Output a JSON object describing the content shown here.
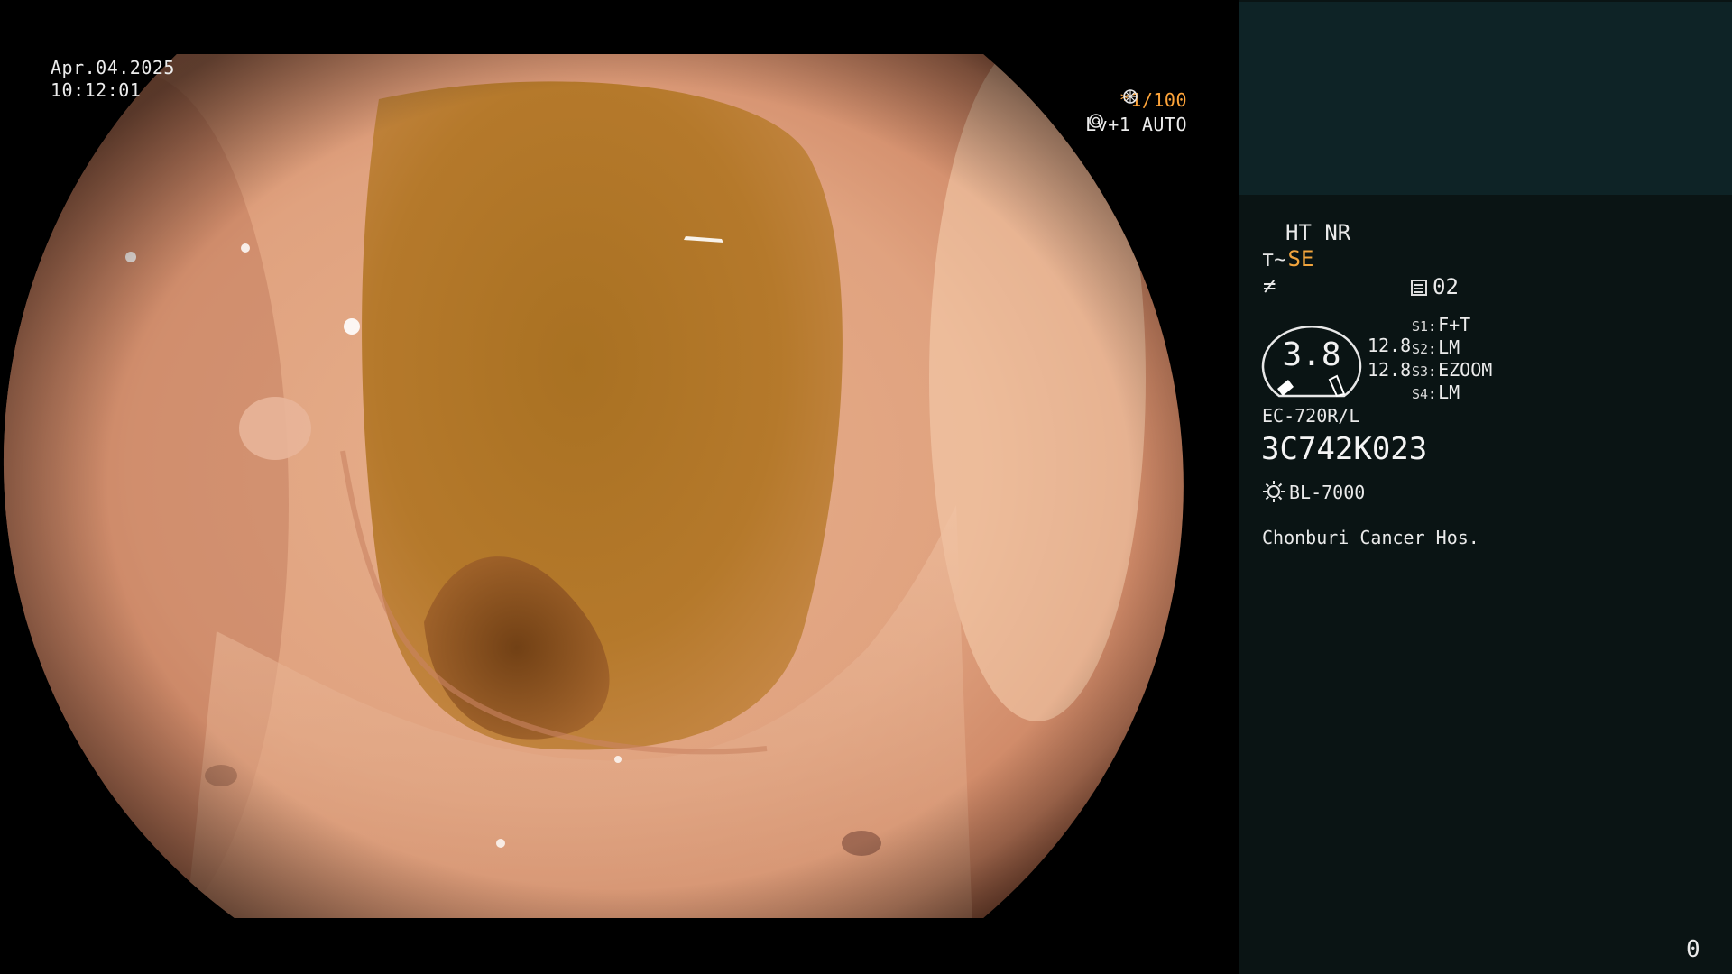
{
  "image": {
    "description_icon": "endoscope-lumen-view",
    "colors": {
      "mucosa": "#d89a78",
      "lumen": "#b57a25",
      "panel_bg": "#0a1414",
      "thumb_bg": "#0e2326",
      "accent_orange": "#f2a53d"
    }
  },
  "overlay": {
    "date": "Apr.04.2025",
    "time": "10:12:01",
    "shutter": "*1/100",
    "shutter_icon": "shutter-icon",
    "iris": "Lv+1 AUTO",
    "iris_icon": "iris-icon"
  },
  "panel": {
    "mode": "HT NR",
    "enhance_symbol": "⊤~",
    "enhance": "SE",
    "fh_symbol": "≠",
    "record_icon": "record-list-icon",
    "record_value": "02",
    "zoom_value": "3.8",
    "contrast_top": "12.8",
    "contrast_bottom": "12.8",
    "switches": [
      {
        "key": "S1:",
        "value": "F+T"
      },
      {
        "key": "S2:",
        "value": "LM"
      },
      {
        "key": "S3:",
        "value": "EZOOM"
      },
      {
        "key": "S4:",
        "value": "LM"
      }
    ],
    "scope_model": "EC-720R/L",
    "serial": "3C742K023",
    "light_icon": "sun-icon",
    "light_source": "BL-7000",
    "hospital": "Chonburi Cancer Hos.",
    "counter": "0"
  }
}
